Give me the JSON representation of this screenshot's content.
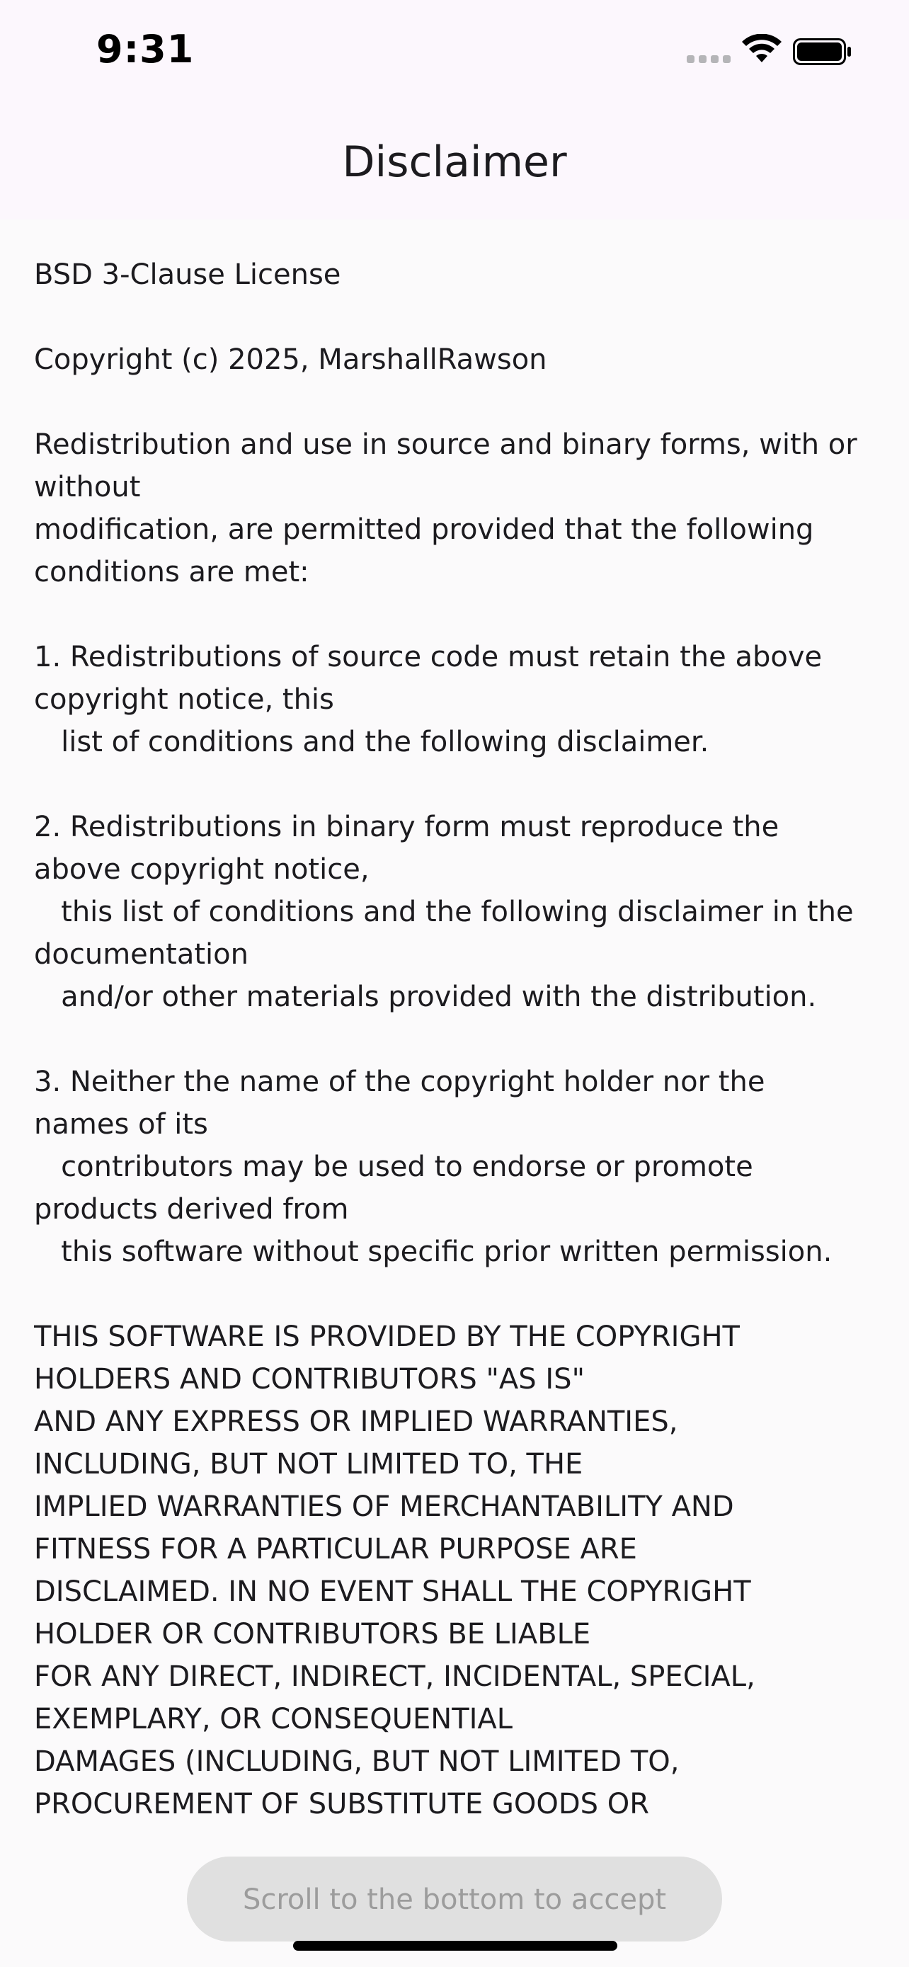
{
  "status_bar": {
    "time": "9:31",
    "icons": [
      "cellular-signal-icon",
      "wifi-icon",
      "battery-icon"
    ]
  },
  "app_bar": {
    "title": "Disclaimer"
  },
  "license": {
    "text": "BSD 3-Clause License\n\nCopyright (c) 2025, MarshallRawson\n\nRedistribution and use in source and binary forms, with or\nwithout\nmodification, are permitted provided that the following\nconditions are met:\n\n1. Redistributions of source code must retain the above\ncopyright notice, this\n   list of conditions and the following disclaimer.\n\n2. Redistributions in binary form must reproduce the\nabove copyright notice,\n   this list of conditions and the following disclaimer in the\ndocumentation\n   and/or other materials provided with the distribution.\n\n3. Neither the name of the copyright holder nor the\nnames of its\n   contributors may be used to endorse or promote\nproducts derived from\n   this software without specific prior written permission.\n\nTHIS SOFTWARE IS PROVIDED BY THE COPYRIGHT\nHOLDERS AND CONTRIBUTORS \"AS IS\"\nAND ANY EXPRESS OR IMPLIED WARRANTIES,\nINCLUDING, BUT NOT LIMITED TO, THE\nIMPLIED WARRANTIES OF MERCHANTABILITY AND\nFITNESS FOR A PARTICULAR PURPOSE ARE\nDISCLAIMED. IN NO EVENT SHALL THE COPYRIGHT\nHOLDER OR CONTRIBUTORS BE LIABLE\nFOR ANY DIRECT, INDIRECT, INCIDENTAL, SPECIAL,\nEXEMPLARY, OR CONSEQUENTIAL\nDAMAGES (INCLUDING, BUT NOT LIMITED TO,\nPROCUREMENT OF SUBSTITUTE GOODS OR"
  },
  "accept_button": {
    "label": "Scroll to the bottom to accept",
    "enabled": false
  },
  "colors": {
    "background": "#fbfafb",
    "app_bar": "#fcf7fd",
    "button_disabled_bg": "#e0e0e0",
    "button_disabled_text": "#9c9c9c",
    "text": "#1c1b1f"
  }
}
